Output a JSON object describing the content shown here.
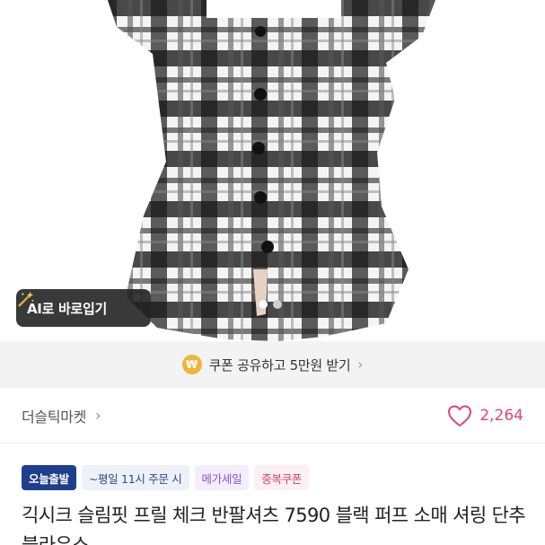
{
  "ai_button": {
    "label": "AI로 바로입기",
    "icon": "magic-wand-icon"
  },
  "carousel": {
    "total_dots": 2,
    "active_index": 0
  },
  "coupon": {
    "icon": "won-coin-icon",
    "icon_glyph": "₩",
    "text": "쿠폰 공유하고 5만원 받기",
    "chevron": "›"
  },
  "shop": {
    "name": "더슬틱마켓",
    "chevron": "›",
    "likes": "2,264"
  },
  "tags": {
    "today": "오늘출발",
    "time": "~평일 11시 주문 시",
    "sale": "메가세일",
    "coupon": "중복쿠폰"
  },
  "product": {
    "title": "긱시크 슬림핏 프릴 체크 반팔셔츠 7590 블랙 퍼프 소매 셔링 단추 블라우스"
  },
  "colors": {
    "like": "#e0457b",
    "today_tag": "#1f3f8c",
    "coupon_coin": "#f0b43c"
  }
}
